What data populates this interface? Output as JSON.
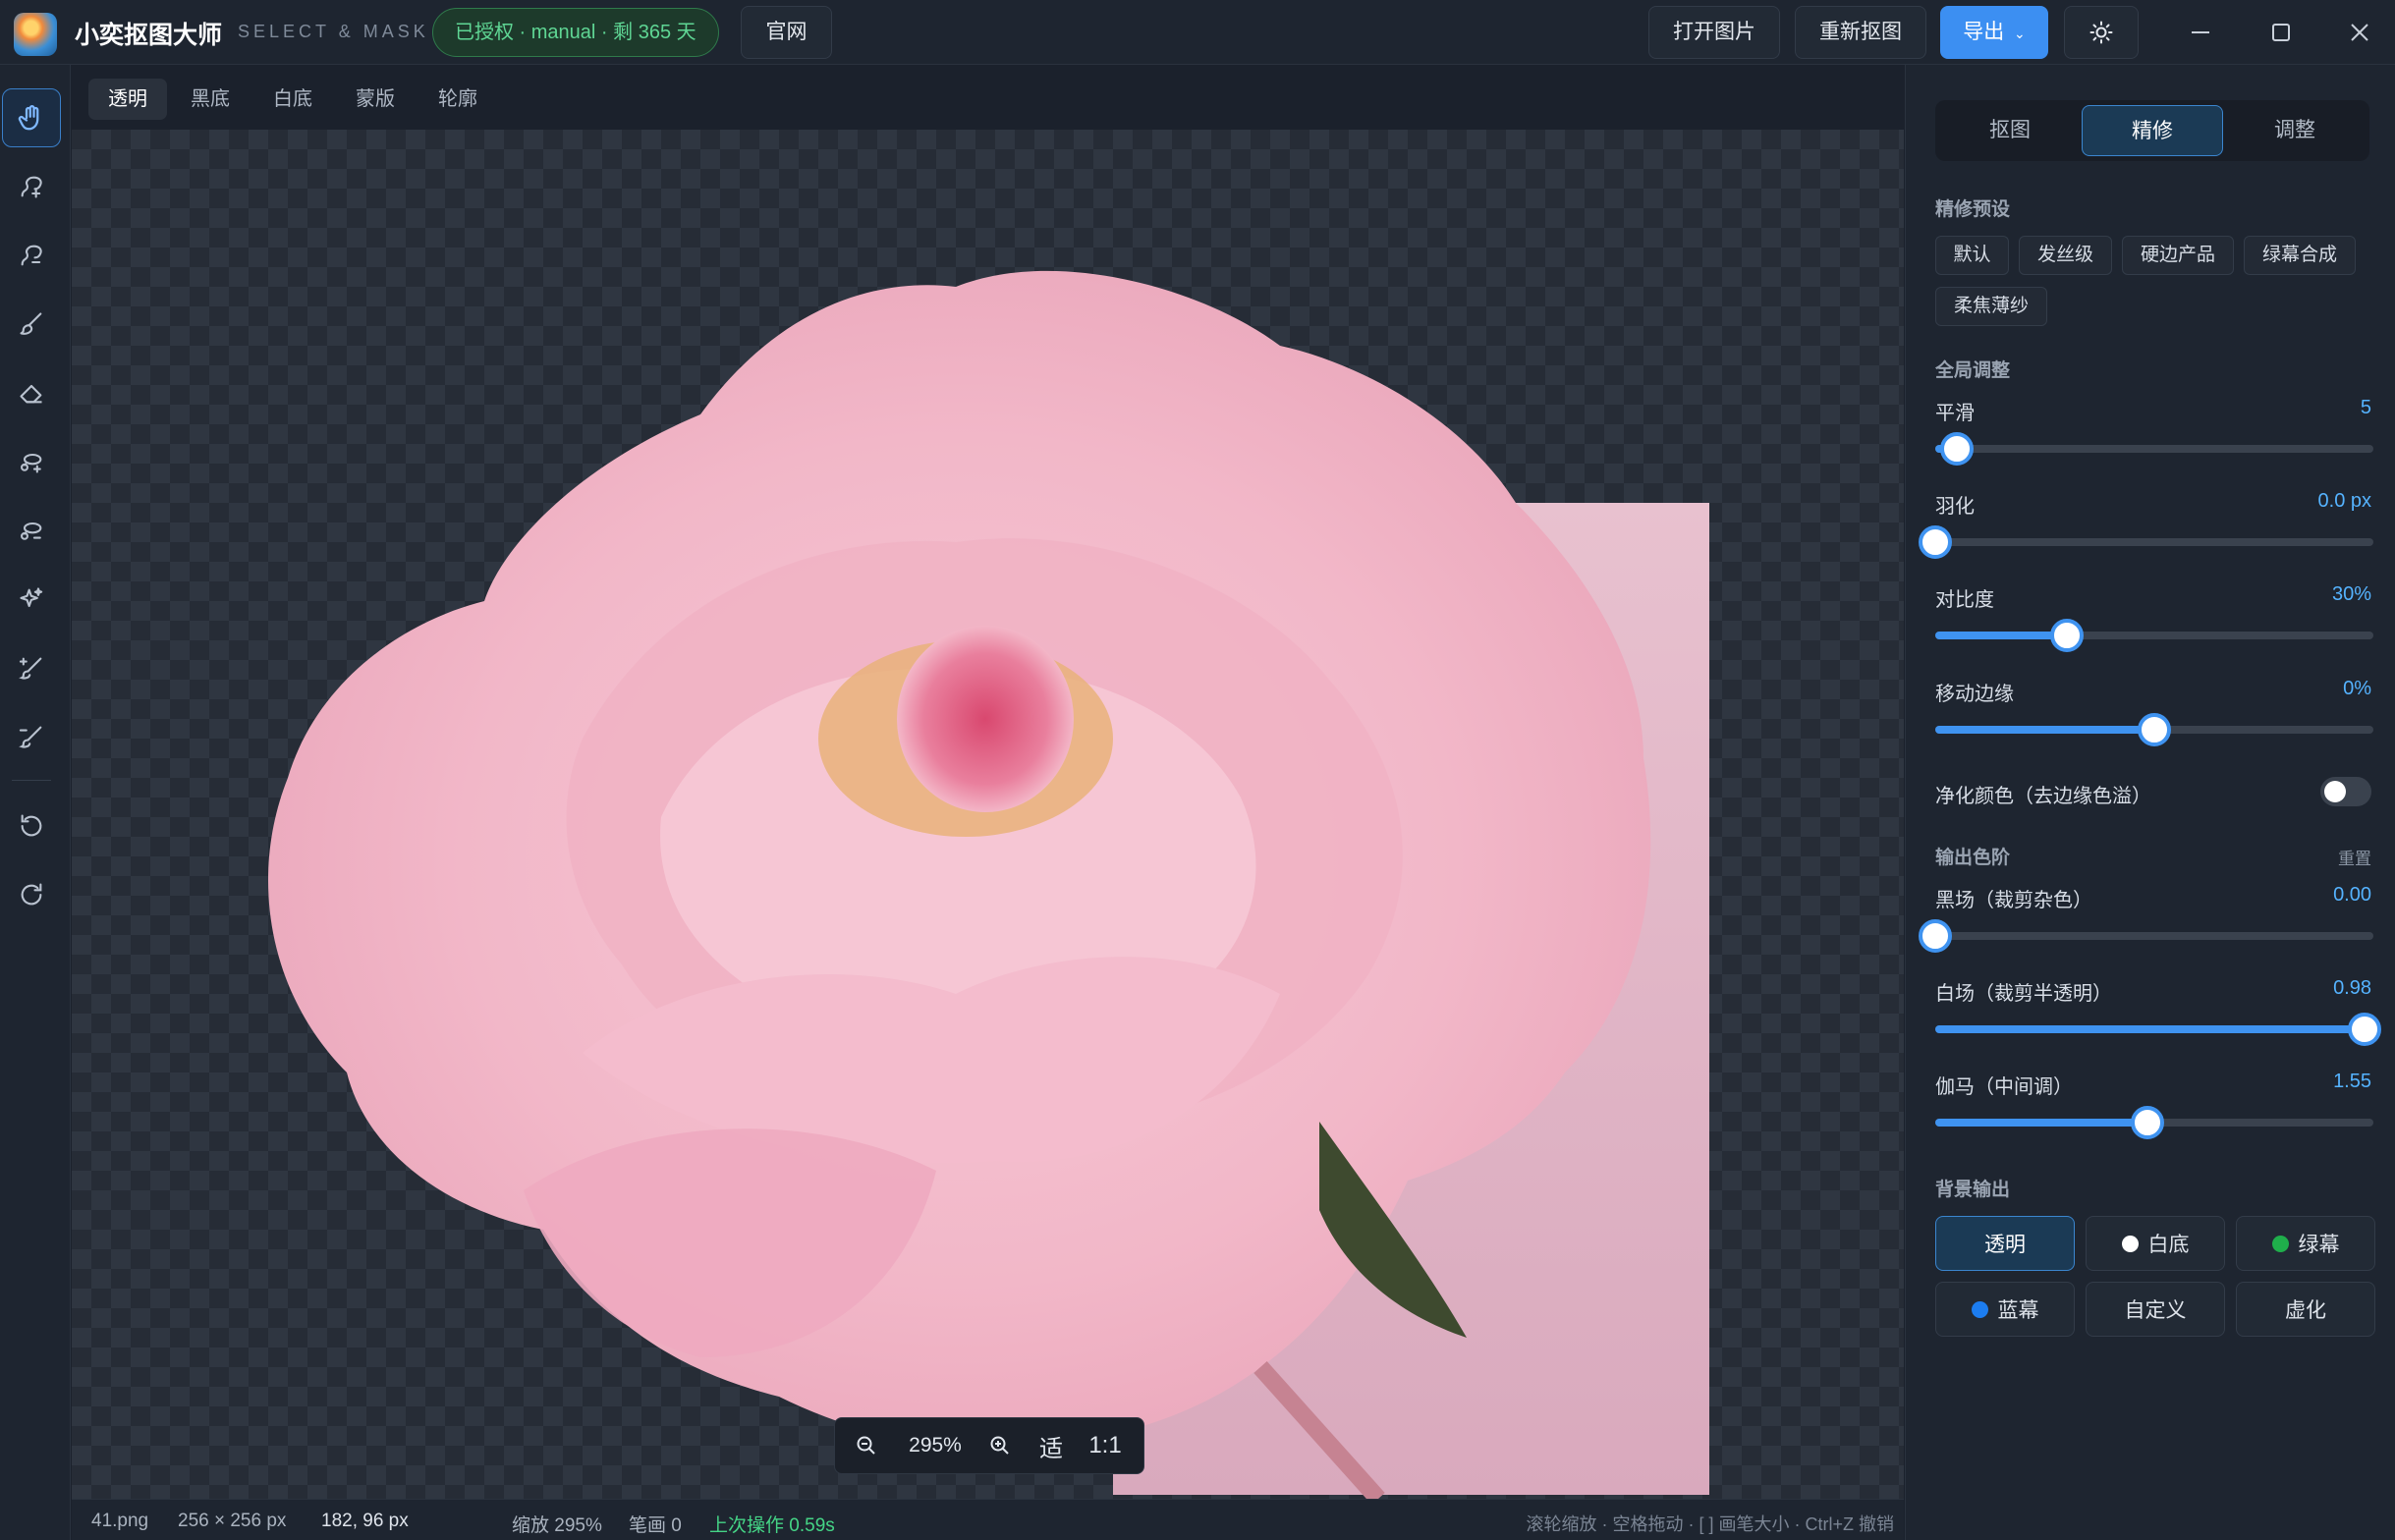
{
  "app": {
    "title": "小奕抠图大师",
    "subtitle": "SELECT & MASK",
    "license": "已授权 · manual · 剩 365 天",
    "website": "官网"
  },
  "header": {
    "open_image": "打开图片",
    "recut": "重新抠图",
    "export": "导出",
    "theme_icon": "sun-icon"
  },
  "tools": [
    {
      "name": "hand-icon",
      "active": true
    },
    {
      "name": "add-select-icon"
    },
    {
      "name": "subtract-select-icon"
    },
    {
      "name": "brush-icon"
    },
    {
      "name": "eraser-icon"
    },
    {
      "name": "lasso-add-icon"
    },
    {
      "name": "lasso-subtract-icon"
    },
    {
      "name": "magic-sparkle-icon"
    },
    {
      "name": "refine-brush-add-icon"
    },
    {
      "name": "refine-brush-subtract-icon"
    },
    {
      "name": "undo-icon"
    },
    {
      "name": "redo-icon"
    }
  ],
  "view_tabs": [
    "透明",
    "黑底",
    "白底",
    "蒙版",
    "轮廓"
  ],
  "active_view": "透明",
  "zoom_bar": {
    "zoom_text": "295%",
    "fit_label": "适",
    "one_to_one": "1:1"
  },
  "status": {
    "file": "41.png",
    "size": "256 × 256 px",
    "cursor": "182, 96 px",
    "zoom": "缩放 295%",
    "strokes": "笔画 0",
    "last_op": "上次操作 0.59s",
    "hint": "滚轮缩放 · 空格拖动 · [ ] 画笔大小 · Ctrl+Z 撤销"
  },
  "panel": {
    "tabs": [
      "抠图",
      "精修",
      "调整"
    ],
    "active_tab": "精修",
    "presets_title": "精修预设",
    "presets": [
      "默认",
      "发丝级",
      "硬边产品",
      "绿幕合成",
      "柔焦薄纱"
    ],
    "global_title": "全局调整",
    "smooth": {
      "label": "平滑",
      "value": "5",
      "level": 0.05
    },
    "feather": {
      "label": "羽化",
      "value": "0.0 px",
      "level": 0.0
    },
    "contrast": {
      "label": "对比度",
      "value": "30%",
      "level": 0.3
    },
    "shift_edge": {
      "label": "移动边缘",
      "value": "0%",
      "level": 0.5
    },
    "decontaminate": {
      "label": "净化颜色（去边缘色溢）",
      "on": false
    },
    "levels_title": "输出色阶",
    "levels_reset": "重置",
    "black_point": {
      "label": "黑场（裁剪杂色）",
      "value": "0.00",
      "level": 0.0
    },
    "white_point": {
      "label": "白场（裁剪半透明）",
      "value": "0.98",
      "level": 0.98
    },
    "gamma": {
      "label": "伽马（中间调）",
      "value": "1.55",
      "level": 0.485
    },
    "bg_title": "背景输出",
    "bg_options": [
      {
        "label": "透明",
        "swatch": null,
        "active": true
      },
      {
        "label": "白底",
        "swatch": "#ffffff"
      },
      {
        "label": "绿幕",
        "swatch": "#1fae4b"
      },
      {
        "label": "蓝幕",
        "swatch": "#1c7df0"
      },
      {
        "label": "自定义",
        "swatch": null
      },
      {
        "label": "虚化",
        "swatch": null
      }
    ]
  },
  "colors": {
    "accent": "#3f93f0",
    "license_green": "#5fd694",
    "last_op_green": "#45d486"
  }
}
